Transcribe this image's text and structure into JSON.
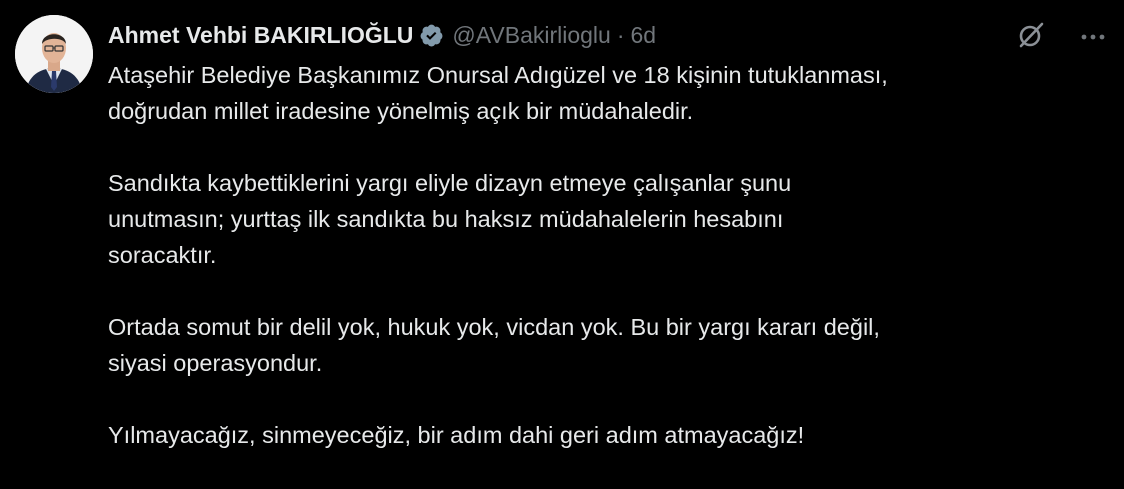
{
  "author": {
    "display_name": "Ahmet Vehbi BAKIRLIOĞLU",
    "handle": "@AVBakirlioglu",
    "separator": "·",
    "time": "6d",
    "verified": true
  },
  "icons": {
    "avatar": "avatar-photo",
    "verified": "verified-badge-icon",
    "grok": "grok-icon",
    "more": "more-options-icon"
  },
  "colors": {
    "background": "#000000",
    "text_primary": "#e7e9ea",
    "text_secondary": "#71767b",
    "verified_badge": "#829aab"
  },
  "tweet": {
    "paragraphs": [
      {
        "lines": [
          "Ataşehir Belediye Başkanımız Onursal Adıgüzel ve 18 kişinin tutuklanması,",
          "doğrudan millet iradesine yönelmiş açık bir müdahaledir."
        ]
      },
      {
        "lines": [
          "Sandıkta kaybettiklerini yargı eliyle dizayn etmeye çalışanlar şunu",
          "unutmasın; yurttaş ilk sandıkta bu haksız müdahalelerin hesabını",
          "soracaktır."
        ]
      },
      {
        "lines": [
          "Ortada somut bir delil yok, hukuk yok, vicdan yok. Bu bir yargı kararı değil,",
          "siyasi operasyondur."
        ]
      },
      {
        "lines": [
          "Yılmayacağız, sinmeyeceğiz, bir adım dahi geri adım atmayacağız!"
        ]
      }
    ]
  }
}
